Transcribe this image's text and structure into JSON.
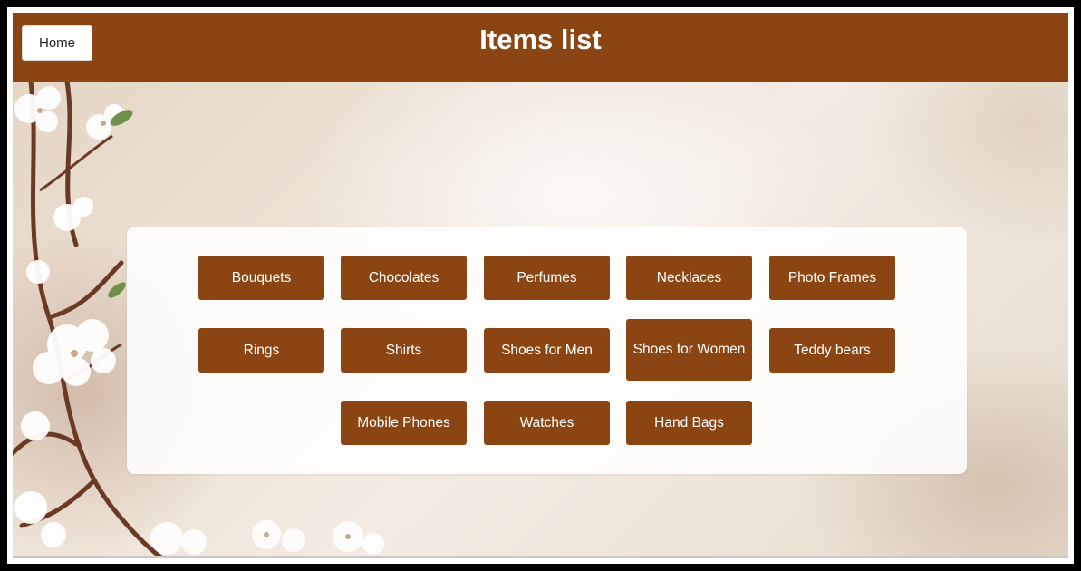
{
  "header": {
    "home_label": "Home",
    "title": "Items list"
  },
  "items": [
    "Bouquets",
    "Chocolates",
    "Perfumes",
    "Necklaces",
    "Photo Frames",
    "Rings",
    "Shirts",
    "Shoes for Men",
    "Shoes for Women",
    "Teddy bears",
    "Mobile Phones",
    "Watches",
    "Hand Bags"
  ],
  "colors": {
    "brand": "#8b4513",
    "button_text": "#ffffff",
    "card_background": "#ffffff"
  },
  "icons": {
    "background_art": "cherry-blossom-branch"
  }
}
